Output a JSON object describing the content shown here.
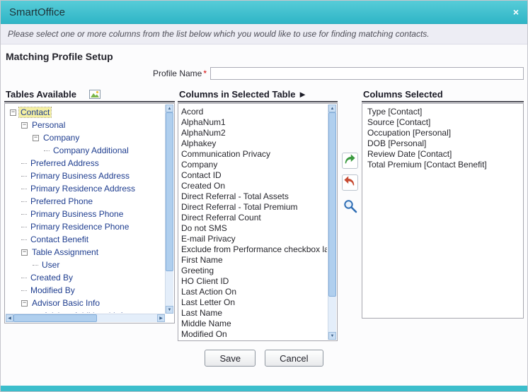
{
  "window": {
    "title": "SmartOffice",
    "close_icon": "×"
  },
  "instruction": "Please select one or more columns from the list below which you would like to use for finding matching contacts.",
  "section_title": "Matching Profile Setup",
  "profile_name": {
    "label": "Profile Name",
    "required_marker": "*",
    "value": ""
  },
  "tables_panel": {
    "title": "Tables Available",
    "icon": "image-icon",
    "tree": [
      {
        "label": "Contact",
        "level": 0,
        "expandable": true,
        "selected": true
      },
      {
        "label": "Personal",
        "level": 1,
        "expandable": true
      },
      {
        "label": "Company",
        "level": 2,
        "expandable": true
      },
      {
        "label": "Company Additional",
        "level": 3,
        "expandable": false
      },
      {
        "label": "Preferred Address",
        "level": 1,
        "expandable": false
      },
      {
        "label": "Primary Business Address",
        "level": 1,
        "expandable": false
      },
      {
        "label": "Primary Residence Address",
        "level": 1,
        "expandable": false
      },
      {
        "label": "Preferred Phone",
        "level": 1,
        "expandable": false
      },
      {
        "label": "Primary Business Phone",
        "level": 1,
        "expandable": false
      },
      {
        "label": "Primary Residence Phone",
        "level": 1,
        "expandable": false
      },
      {
        "label": "Contact Benefit",
        "level": 1,
        "expandable": false
      },
      {
        "label": "Table Assignment",
        "level": 1,
        "expandable": true
      },
      {
        "label": "User",
        "level": 2,
        "expandable": false
      },
      {
        "label": "Created By",
        "level": 1,
        "expandable": false
      },
      {
        "label": "Modified By",
        "level": 1,
        "expandable": false
      },
      {
        "label": "Advisor Basic Info",
        "level": 1,
        "expandable": true
      },
      {
        "label": "Advisor Additional Info",
        "level": 2,
        "expandable": true
      }
    ]
  },
  "columns_panel": {
    "title": "Columns in Selected Table ►",
    "items": [
      "Acord",
      "AlphaNum1",
      "AlphaNum2",
      "Alphakey",
      "Communication Privacy",
      "Company",
      "Contact ID",
      "Created On",
      "Direct Referral - Total Assets",
      "Direct Referral - Total Premium",
      "Direct Referral Count",
      "Do not SMS",
      "E-mail Privacy",
      "Exclude from Performance checkbox last r",
      "First Name",
      "Greeting",
      "HO Client ID",
      "Last Action On",
      "Last Letter On",
      "Last Name",
      "Middle Name",
      "Modified On"
    ]
  },
  "selected_panel": {
    "title": "Columns Selected",
    "items": [
      "Type [Contact]",
      "Source [Contact]",
      "Occupation [Personal]",
      "DOB [Personal]",
      "Review Date [Contact]",
      "Total Premium [Contact Benefit]"
    ]
  },
  "transfer": {
    "add_icon": "curved-right-arrow",
    "remove_icon": "curved-left-arrow",
    "search_icon": "magnifier"
  },
  "footer": {
    "save_label": "Save",
    "cancel_label": "Cancel"
  },
  "icons": {
    "scroll_up": "▲",
    "scroll_down": "▼",
    "scroll_left": "◀",
    "scroll_right": "▶"
  },
  "colors": {
    "titlebar_teal": "#3cbfcd",
    "selected_row_yellow": "#f4efa2",
    "add_arrow_green": "#3a9a3f",
    "remove_arrow_red": "#c74a32",
    "search_blue": "#2e6db4",
    "required_red": "#d40000",
    "tree_text_blue": "#1e3d8f"
  }
}
